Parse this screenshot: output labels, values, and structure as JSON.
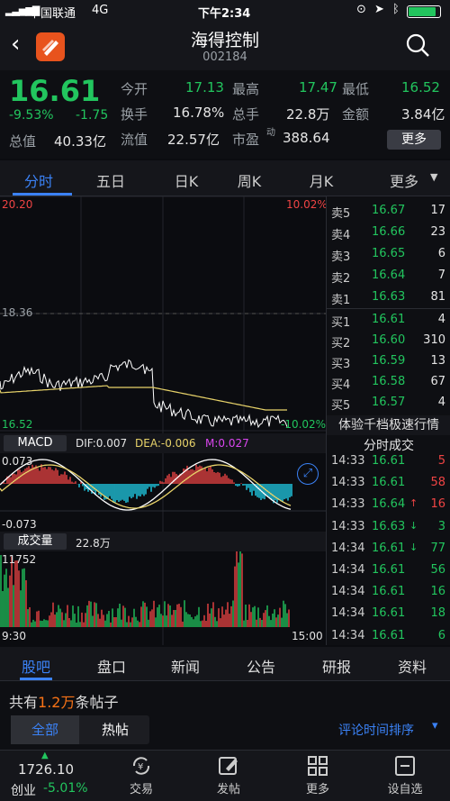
{
  "status": {
    "carrier": "中国联通",
    "network": "4G",
    "time": "下午2:34"
  },
  "header": {
    "title": "海得控制",
    "code": "002184"
  },
  "quote": {
    "price": "16.61",
    "pct": "-9.53%",
    "chg": "-1.75",
    "stats": [
      {
        "label": "今开",
        "value": "17.13",
        "color": "#22c55e"
      },
      {
        "label": "最高",
        "value": "17.47",
        "color": "#22c55e"
      },
      {
        "label": "最低",
        "value": "16.52",
        "color": "#22c55e"
      },
      {
        "label": "换手",
        "value": "16.78%",
        "color": "#e5e5e5"
      },
      {
        "label": "总手",
        "value": "22.8万",
        "color": "#e5e5e5"
      },
      {
        "label": "金额",
        "value": "3.84亿",
        "color": "#e5e5e5"
      },
      {
        "label": "总值",
        "value": "40.33亿",
        "color": "#e5e5e5"
      },
      {
        "label": "流值",
        "value": "22.57亿",
        "color": "#e5e5e5"
      },
      {
        "label": "市盈",
        "value": "388.64",
        "color": "#e5e5e5",
        "sup": "动"
      }
    ],
    "more_label": "更多"
  },
  "tabs": [
    "分时",
    "五日",
    "日K",
    "周K",
    "月K",
    "更多"
  ],
  "chart": {
    "high_price": "20.20",
    "high_pct": "10.02%",
    "mid_price": "18.36",
    "low_price": "16.52",
    "low_pct": "-10.02%",
    "macd_label": "MACD",
    "dif": "DIF:0.007",
    "dea": "DEA:-0.006",
    "m": "M:0.027",
    "macd_top": "0.073",
    "macd_bot": "-0.073",
    "vol_label": "成交量",
    "vol_value": "22.8万",
    "vol_top": "11752",
    "time_start": "9:30",
    "time_end": "15:00"
  },
  "orderbook": {
    "asks": [
      {
        "label": "卖5",
        "price": "16.67",
        "vol": "17"
      },
      {
        "label": "卖4",
        "price": "16.66",
        "vol": "23"
      },
      {
        "label": "卖3",
        "price": "16.65",
        "vol": "6"
      },
      {
        "label": "卖2",
        "price": "16.64",
        "vol": "7"
      },
      {
        "label": "卖1",
        "price": "16.63",
        "vol": "81"
      }
    ],
    "bids": [
      {
        "label": "买1",
        "price": "16.61",
        "vol": "4"
      },
      {
        "label": "买2",
        "price": "16.60",
        "vol": "310"
      },
      {
        "label": "买3",
        "price": "16.59",
        "vol": "13"
      },
      {
        "label": "买4",
        "price": "16.58",
        "vol": "67"
      },
      {
        "label": "买5",
        "price": "16.57",
        "vol": "4"
      }
    ],
    "promo": "体验千档极速行情",
    "ticks_title": "分时成交",
    "ticks": [
      {
        "time": "14:33",
        "price": "16.61",
        "arrow": "",
        "vol": "5",
        "vc": "#ef4444"
      },
      {
        "time": "14:33",
        "price": "16.61",
        "arrow": "",
        "vol": "58",
        "vc": "#ef4444"
      },
      {
        "time": "14:33",
        "price": "16.64",
        "arrow": "↑",
        "vol": "16",
        "vc": "#ef4444"
      },
      {
        "time": "14:33",
        "price": "16.63",
        "arrow": "↓",
        "vol": "3",
        "vc": "#22c55e"
      },
      {
        "time": "14:34",
        "price": "16.61",
        "arrow": "↓",
        "vol": "77",
        "vc": "#22c55e"
      },
      {
        "time": "14:34",
        "price": "16.61",
        "arrow": "",
        "vol": "56",
        "vc": "#22c55e"
      },
      {
        "time": "14:34",
        "price": "16.61",
        "arrow": "",
        "vol": "16",
        "vc": "#22c55e"
      },
      {
        "time": "14:34",
        "price": "16.61",
        "arrow": "",
        "vol": "18",
        "vc": "#22c55e"
      },
      {
        "time": "14:34",
        "price": "16.61",
        "arrow": "",
        "vol": "6",
        "vc": "#22c55e"
      }
    ]
  },
  "bottom_tabs": [
    "股吧",
    "盘口",
    "新闻",
    "公告",
    "研报",
    "资料"
  ],
  "posts": {
    "prefix": "共有",
    "count": "1.2万",
    "suffix": "条帖子",
    "filter_all": "全部",
    "filter_hot": "热帖",
    "sort": "评论时间排序"
  },
  "nav": {
    "index_value": "1726.10",
    "index_name": "创业",
    "index_pct": "-5.01%",
    "items": [
      "交易",
      "发帖",
      "更多",
      "设自选"
    ]
  },
  "colors": {
    "up": "#ef4444",
    "down": "#22c55e",
    "accent": "#3b82f6",
    "avg": "#e8d36a"
  }
}
